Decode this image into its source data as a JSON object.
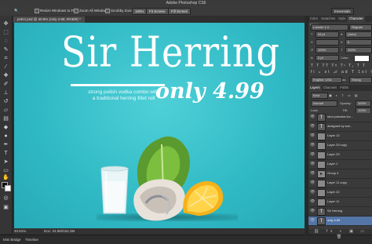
{
  "app": {
    "title": "Adobe Photoshop CS6"
  },
  "options_bar": {
    "resize_label": "Resize Windows to Fit",
    "zoom_all_label": "Zoom All Windows",
    "scrubby_label": "Scrubby Zoom",
    "zoom_value": "100%",
    "fit_screen": "Fit Screen",
    "fill_screen": "Fill Screen",
    "workspace": "Essentials"
  },
  "document": {
    "tab_label": "pskr4.psd @ 40.8% (only 4.99, RGB/8) *"
  },
  "artwork": {
    "headline": "Sir Herring",
    "tagline_line1": "strong polish vodka combo with",
    "tagline_line2": "a traditional herring fillet roll",
    "price": "only 4.99",
    "colors": {
      "background": "#33bcc6",
      "text": "#ffffff"
    }
  },
  "status": {
    "zoom": "40.81%",
    "doc_size": "Doc: 24.9M/162.3M"
  },
  "bottom_tabs": [
    "Mini Bridge",
    "Timeline"
  ],
  "panels": {
    "top_tabs": [
      "Color",
      "Swatches",
      "Style",
      "Character",
      "Parag"
    ],
    "active_top_tab": "Character",
    "font_family": "Lobster 1.4",
    "font_style": "Regular",
    "font_size": "54 pt",
    "leading": "(Auto)",
    "tracking": "0",
    "scale_v": "100%",
    "scale_h": "100%",
    "baseline": "0 pt",
    "color_label": "Color:",
    "language": "English: USA",
    "antialias": "Strong",
    "layer_tabs": [
      "Layers",
      "Channels",
      "Paths"
    ],
    "kind_label": "Kind",
    "blend_mode": "Normal",
    "opacity_label": "Opacity:",
    "opacity_value": "100%",
    "lock_label": "Lock:",
    "fill_label": "Fill:",
    "fill_value": "100%",
    "layers": [
      {
        "name": "shot polewka krz...",
        "type": "text",
        "selected": false
      },
      {
        "name": "designed by see...",
        "type": "text",
        "selected": false
      },
      {
        "name": "Layer 12",
        "type": "image",
        "selected": false
      },
      {
        "name": "Layer 29 copy",
        "type": "image",
        "selected": false
      },
      {
        "name": "Layer 29",
        "type": "image",
        "selected": false
      },
      {
        "name": "Layer 1",
        "type": "image",
        "selected": false
      },
      {
        "name": "Group 4",
        "type": "group",
        "selected": false
      },
      {
        "name": "Layer 11 copy",
        "type": "image",
        "selected": false
      },
      {
        "name": "Layer 22",
        "type": "image",
        "selected": false
      },
      {
        "name": "Layer 11",
        "type": "image",
        "selected": false
      },
      {
        "name": "Sir Herring",
        "type": "text",
        "selected": false
      },
      {
        "name": "only 4.99",
        "type": "text",
        "selected": true
      }
    ]
  }
}
